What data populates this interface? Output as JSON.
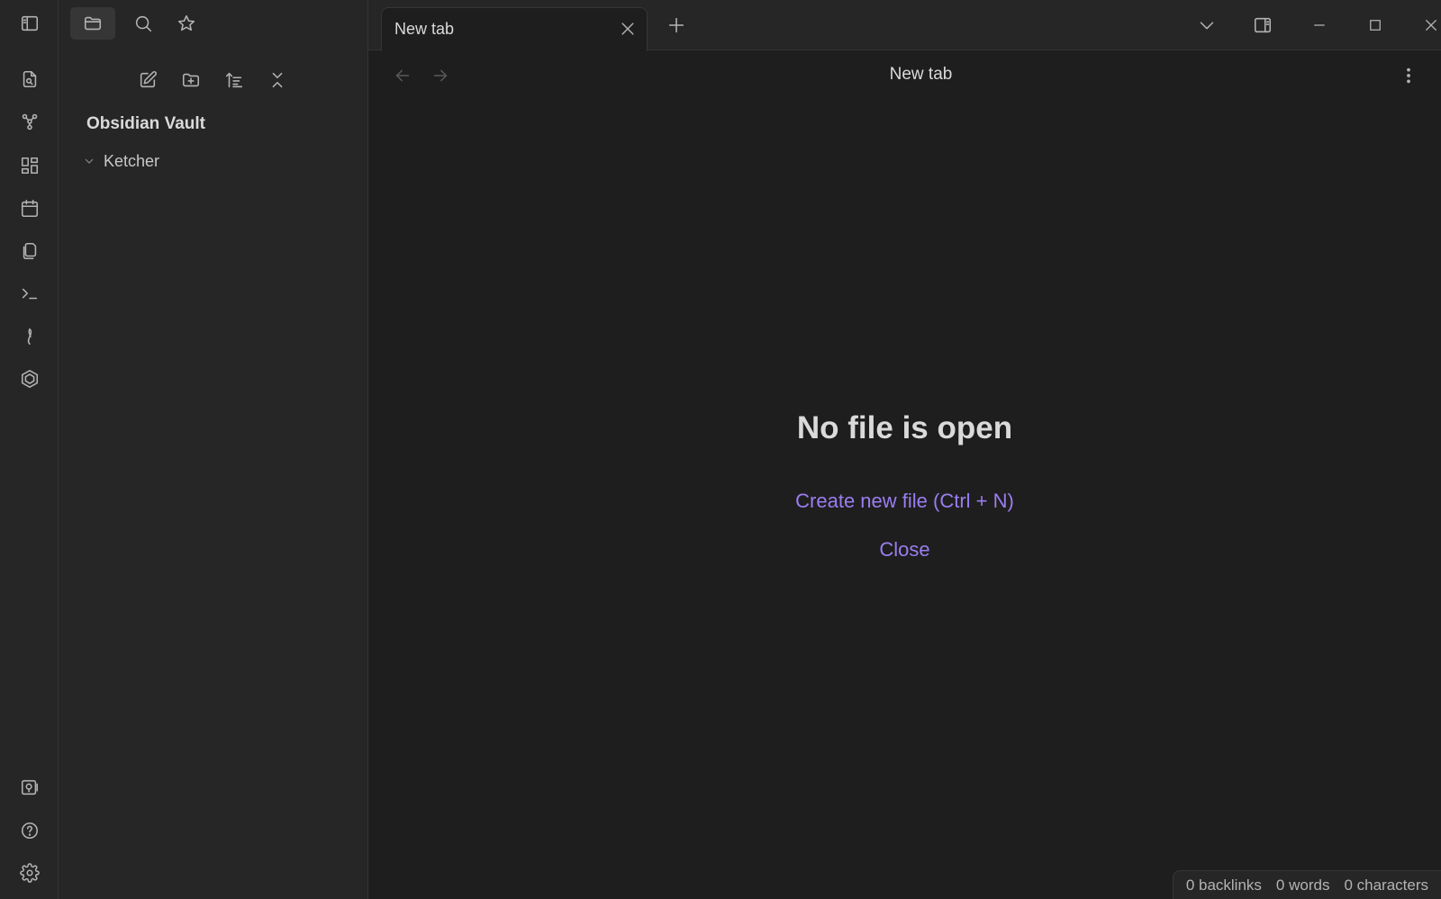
{
  "sidebar": {
    "vault_name": "Obsidian Vault",
    "tree": [
      {
        "name": "Ketcher",
        "type": "folder",
        "expanded": true
      }
    ]
  },
  "tabs": [
    {
      "label": "New tab",
      "active": true
    }
  ],
  "view": {
    "title": "New tab"
  },
  "empty_state": {
    "heading": "No file is open",
    "create_link": "Create new file (Ctrl + N)",
    "close_link": "Close"
  },
  "statusbar": {
    "backlinks": "0 backlinks",
    "words": "0 words",
    "characters": "0 characters"
  },
  "colors": {
    "accent": "#9a7ef0",
    "background": "#1e1e1e",
    "panel": "#262626"
  }
}
